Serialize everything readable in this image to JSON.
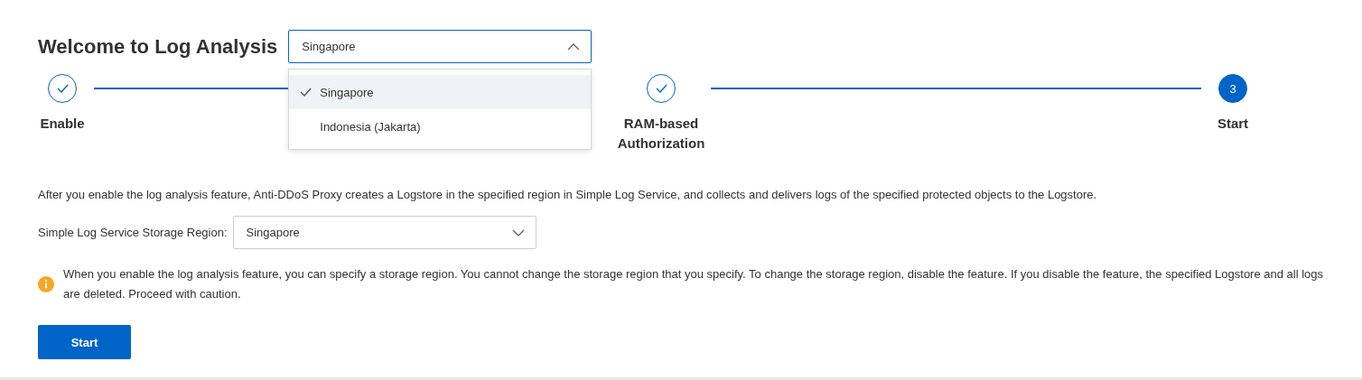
{
  "title": "Welcome to Log Analysis",
  "region_select": {
    "value": "Singapore",
    "expanded": true,
    "options": [
      {
        "label": "Singapore",
        "selected": true
      },
      {
        "label": "Indonesia (Jakarta)",
        "selected": false
      }
    ]
  },
  "steps": [
    {
      "label": "Enable",
      "done": true
    },
    {
      "label": "RAM-based Authorization",
      "done": true
    },
    {
      "label": "Start",
      "done": false,
      "number": "3"
    }
  ],
  "description": "After you enable the log analysis feature, Anti-DDoS Proxy creates a Logstore in the specified region in Simple Log Service, and collects and delivers logs of the specified protected objects to the Logstore.",
  "storage_region": {
    "label": "Simple Log Service Storage Region:",
    "value": "Singapore",
    "expanded": false
  },
  "notice": "When you enable the log analysis feature, you can specify a storage region. You cannot change the storage region that you specify. To change the storage region, disable the feature. If you disable the feature, the specified Logstore and all logs are deleted. Proceed with caution.",
  "start_button": "Start"
}
